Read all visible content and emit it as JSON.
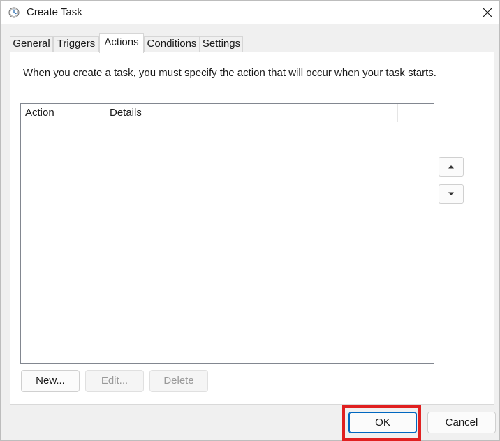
{
  "window": {
    "title": "Create Task",
    "close_label": "Close"
  },
  "tabs": [
    {
      "label": "General",
      "active": false
    },
    {
      "label": "Triggers",
      "active": false
    },
    {
      "label": "Actions",
      "active": true
    },
    {
      "label": "Conditions",
      "active": false
    },
    {
      "label": "Settings",
      "active": false
    }
  ],
  "panel": {
    "description": "When you create a task, you must specify the action that will occur when your task starts.",
    "list": {
      "columns": [
        "Action",
        "Details",
        ""
      ],
      "rows": []
    },
    "move_up_icon": "triangle-up-icon",
    "move_down_icon": "triangle-down-icon",
    "buttons": {
      "new": "New...",
      "edit": "Edit...",
      "delete": "Delete"
    }
  },
  "footer": {
    "ok": "OK",
    "cancel": "Cancel"
  },
  "colors": {
    "highlight": "#e02020",
    "accent": "#0067c0"
  }
}
